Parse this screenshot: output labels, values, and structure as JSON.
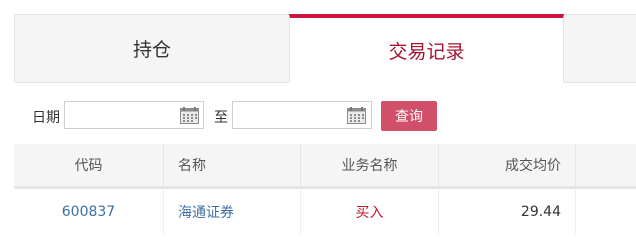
{
  "tabs": [
    {
      "label": "持仓",
      "active": false
    },
    {
      "label": "交易记录",
      "active": true
    }
  ],
  "filter": {
    "date_label": "日期",
    "start_value": "",
    "to_label": "至",
    "end_value": "",
    "calendar_icon": "calendar-icon",
    "query_label": "查询"
  },
  "table": {
    "headers": [
      "代码",
      "名称",
      "业务名称",
      "成交均价"
    ],
    "rows": [
      {
        "code": "600837",
        "name": "海通证券",
        "business": "买入",
        "avg_price": "29.44"
      }
    ]
  },
  "colors": {
    "accent": "#c8163c",
    "active_tab_text": "#a51431",
    "button": "#d0506a",
    "link": "#3e6fa4",
    "buy": "#c0182f"
  }
}
